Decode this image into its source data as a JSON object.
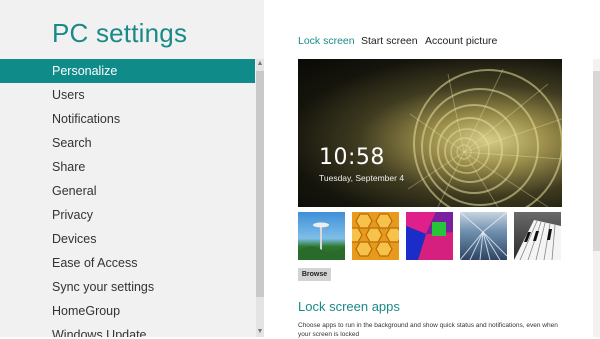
{
  "app": {
    "title": "PC settings"
  },
  "sidebar": {
    "items": [
      {
        "label": "Personalize",
        "selected": true
      },
      {
        "label": "Users"
      },
      {
        "label": "Notifications"
      },
      {
        "label": "Search"
      },
      {
        "label": "Share"
      },
      {
        "label": "General"
      },
      {
        "label": "Privacy"
      },
      {
        "label": "Devices"
      },
      {
        "label": "Ease of Access"
      },
      {
        "label": "Sync your settings"
      },
      {
        "label": "HomeGroup"
      },
      {
        "label": "Windows Update"
      }
    ],
    "scroll_up_icon": "chevron-up-icon",
    "scroll_down_icon": "chevron-down-icon"
  },
  "main": {
    "tabs": [
      {
        "label": "Lock screen",
        "active": true
      },
      {
        "label": "Start screen"
      },
      {
        "label": "Account picture"
      }
    ],
    "preview": {
      "time": "10:58",
      "date": "Tuesday, September 4",
      "image": "nautilus-shell"
    },
    "thumbnails": [
      {
        "name": "space-needle"
      },
      {
        "name": "honeycomb"
      },
      {
        "name": "color-cubes"
      },
      {
        "name": "motion-tunnel"
      },
      {
        "name": "piano-keys"
      }
    ],
    "browse_label": "Browse",
    "lock_apps": {
      "title": "Lock screen apps",
      "description": "Choose apps to run in the background and show quick status and notifications, even when your screen is locked"
    }
  },
  "colors": {
    "accent": "#0f8c8a",
    "accent_text": "#1a8a88",
    "sidebar_bg": "#f1f1f1",
    "content_bg": "#ffffff"
  }
}
